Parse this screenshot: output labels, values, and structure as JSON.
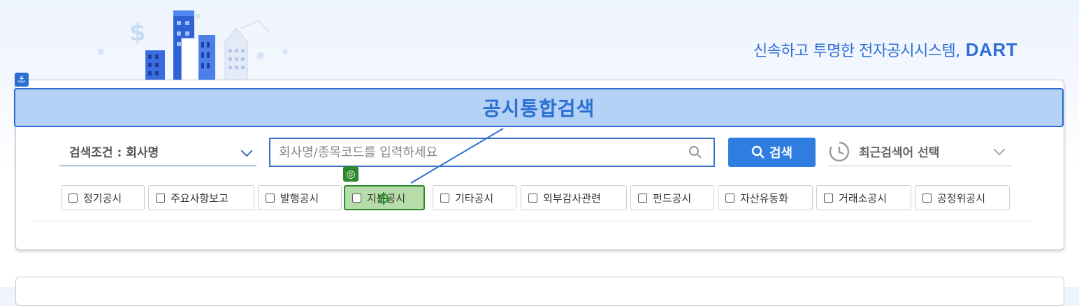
{
  "header": {
    "tagline": "신속하고 투명한 전자공시시스템,",
    "brand": "DART"
  },
  "search_panel": {
    "title": "공시통합검색",
    "condition": {
      "label": "검색조건 : 회사명"
    },
    "search_input": {
      "value": "",
      "placeholder": "회사명/종목코드를 입력하세요"
    },
    "search_button": {
      "label": "검색"
    },
    "recent": {
      "label": "최근검색어 선택"
    },
    "disclosure_types": [
      {
        "label": "정기공시"
      },
      {
        "label": "주요사항보고"
      },
      {
        "label": "발행공시"
      },
      {
        "label": "지분공시"
      },
      {
        "label": "기타공시"
      },
      {
        "label": "외부감사관련"
      },
      {
        "label": "펀드공시"
      },
      {
        "label": "자산유동화"
      },
      {
        "label": "거래소공시"
      },
      {
        "label": "공정위공시"
      }
    ]
  },
  "colors": {
    "accent": "#2f7de1",
    "title_highlight": "#b4d1f6",
    "selection_highlight": "#b6dcaa"
  },
  "icons": {
    "anchor": "anchor-icon",
    "target": "target-icon",
    "search": "search-icon",
    "history": "clock-history-icon"
  }
}
